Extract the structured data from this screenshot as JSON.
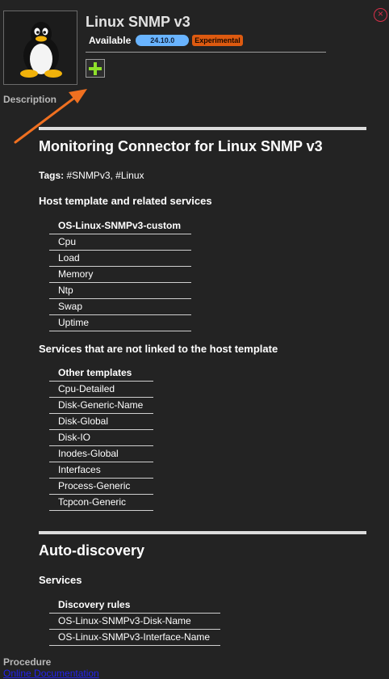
{
  "header": {
    "title": "Linux SNMP v3",
    "status_label": "Available",
    "version": "24.10.0",
    "stability": "Experimental",
    "description_label": "Description",
    "logo_icon": "tux-penguin-icon",
    "add_icon": "plus-icon",
    "close_icon": "close-icon"
  },
  "content": {
    "connector_title": "Monitoring Connector for Linux SNMP v3",
    "tags_label": "Tags:",
    "tags": "#SNMPv3, #Linux",
    "host_section_title": "Host template and related services",
    "host_table": [
      "OS-Linux-SNMPv3-custom",
      "Cpu",
      "Load",
      "Memory",
      "Ntp",
      "Swap",
      "Uptime"
    ],
    "unlinked_section_title": "Services that are not linked to the host template",
    "unlinked_table": [
      "Other templates",
      "Cpu-Detailed",
      "Disk-Generic-Name",
      "Disk-Global",
      "Disk-IO",
      "Inodes-Global",
      "Interfaces",
      "Process-Generic",
      "Tcpcon-Generic"
    ],
    "discovery_title": "Auto-discovery",
    "discovery_services_title": "Services",
    "discovery_table": [
      "Discovery rules",
      "OS-Linux-SNMPv3-Disk-Name",
      "OS-Linux-SNMPv3-Interface-Name"
    ]
  },
  "footer": {
    "procedure_label": "Procedure",
    "doc_link": "Online Documentation"
  },
  "colors": {
    "background": "#232323",
    "version_badge": "#69b4ff",
    "experimental_badge": "#dd5a10",
    "add_icon": "#8ee02a",
    "close_icon": "#d9304a",
    "arrow": "#f07020",
    "link": "#2323f0"
  }
}
